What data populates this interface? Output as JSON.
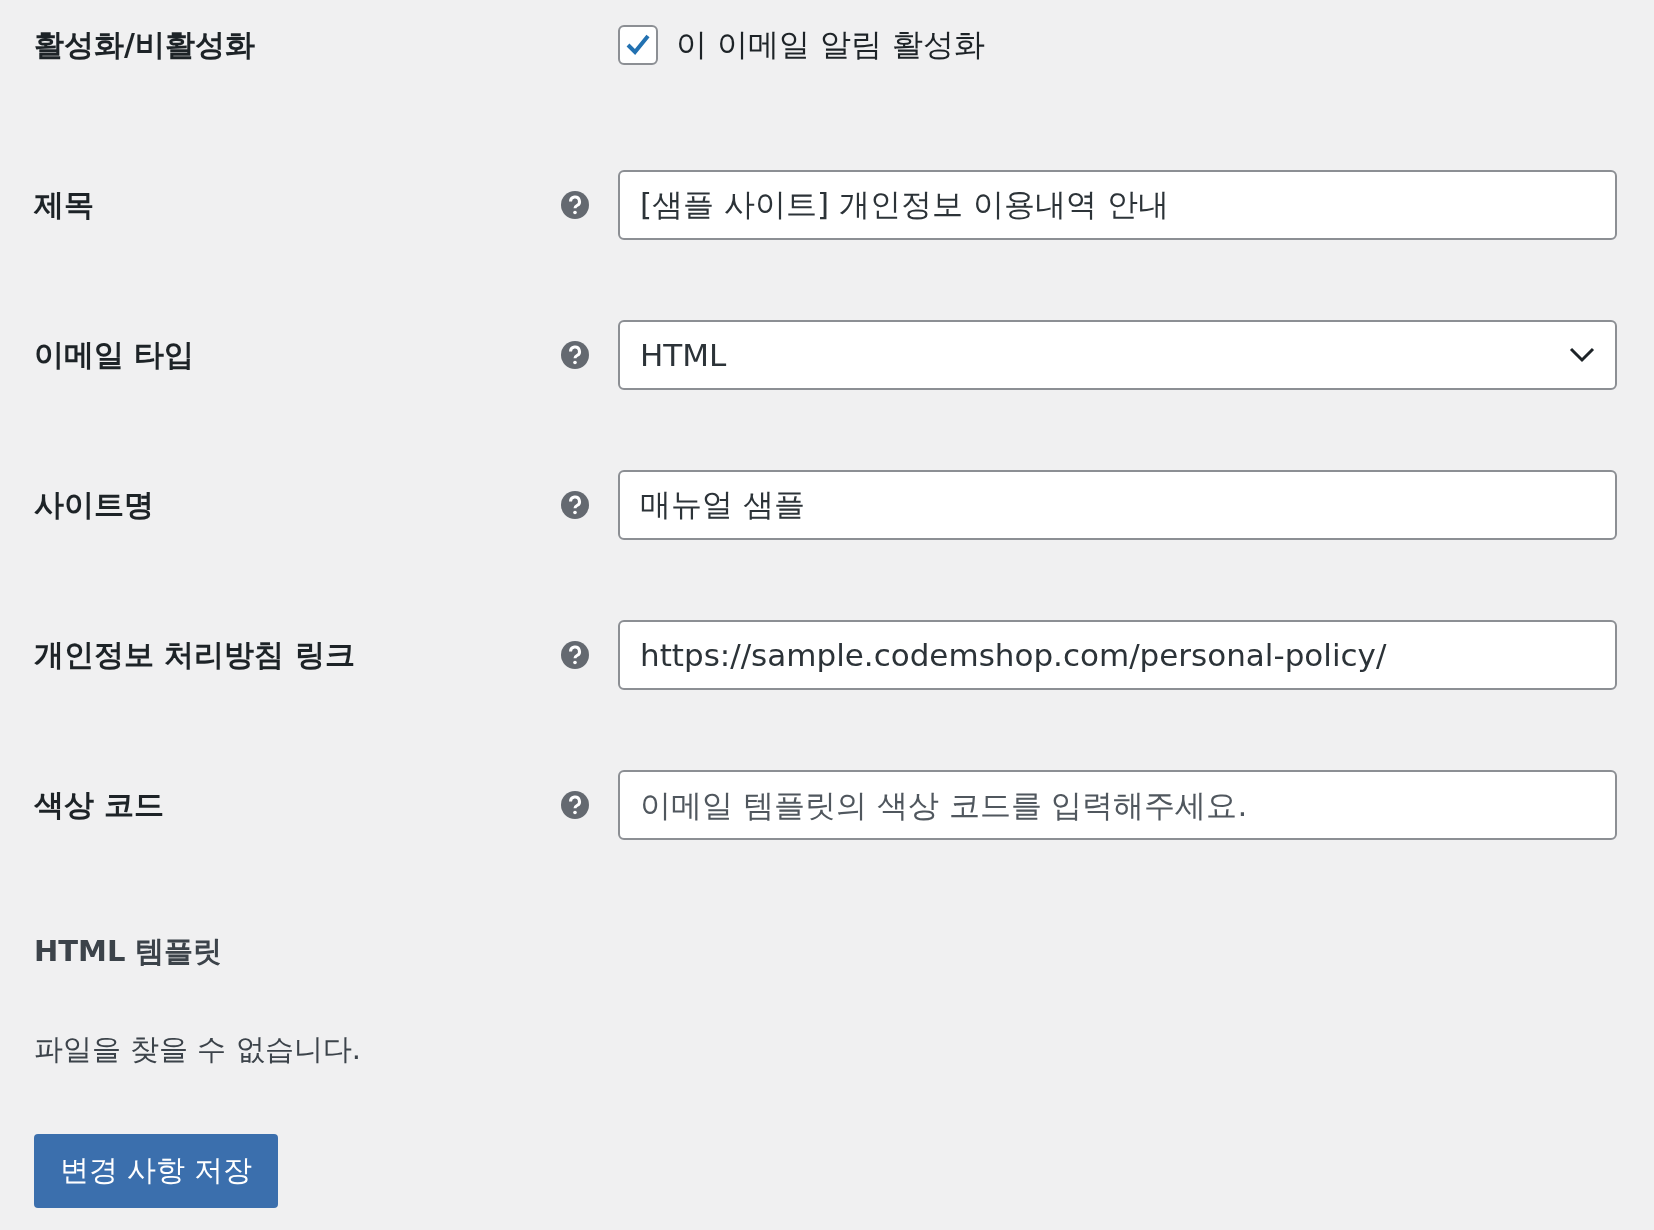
{
  "enable": {
    "label": "활성화/비활성화",
    "checkbox": {
      "label": "이 이메일 알림 활성화",
      "checked": true
    }
  },
  "fields": [
    {
      "kind": "input",
      "label": "제목",
      "value": "[샘플 사이트] 개인정보 이용내역 안내"
    },
    {
      "kind": "select",
      "label": "이메일 타입",
      "value": "HTML"
    },
    {
      "kind": "input",
      "label": "사이트명",
      "value": "매뉴얼 샘플"
    },
    {
      "kind": "input",
      "label": "개인정보 처리방침 링크",
      "value": "https://sample.codemshop.com/personal-policy/"
    },
    {
      "kind": "input",
      "label": "색상 코드",
      "placeholder": "이메일 템플릿의 색상 코드를 입력해주세요."
    }
  ],
  "template": {
    "heading": "HTML 템플릿",
    "message": "파일을 찾을 수 없습니다."
  },
  "save_button": "변경 사항 저장"
}
